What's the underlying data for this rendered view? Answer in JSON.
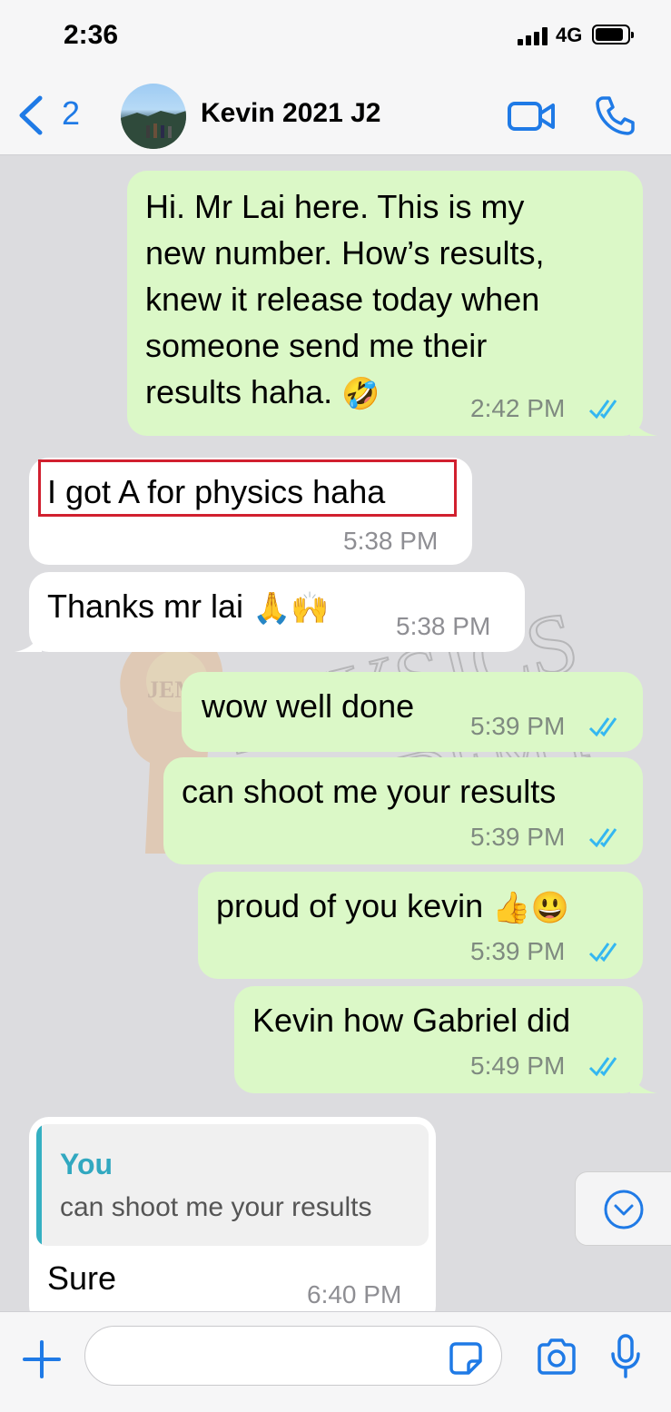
{
  "status_bar": {
    "time": "2:36",
    "network": "4G"
  },
  "header": {
    "back_count": "2",
    "contact_name": "Kevin 2021 J2"
  },
  "messages": [
    {
      "direction": "out",
      "text": "Hi. Mr Lai here. This is my\nnew number. How’s results,\nknew it release today when\nsomeone send me their\nresults haha.",
      "emoji": "🤣",
      "time": "2:42 PM",
      "read": true
    },
    {
      "direction": "in",
      "text": "I got A for physics haha",
      "time": "5:38 PM"
    },
    {
      "direction": "in",
      "text": "Thanks mr lai",
      "emoji": "🙏🙌",
      "time": "5:38 PM"
    },
    {
      "direction": "out",
      "text": "wow well done",
      "time": "5:39 PM",
      "read": true
    },
    {
      "direction": "out",
      "text": "can shoot me your results",
      "time": "5:39 PM",
      "read": true
    },
    {
      "direction": "out",
      "text": "proud of you kevin",
      "emoji": "👍😃",
      "time": "5:39 PM",
      "read": true
    },
    {
      "direction": "out",
      "text": "Kevin how Gabriel did",
      "time": "5:49 PM",
      "read": true
    },
    {
      "direction": "in",
      "quoted_author": "You",
      "quoted_text": "can shoot me your results",
      "text": "Sure",
      "time": "6:40 PM"
    }
  ],
  "watermark": {
    "line1": "PHYSICS",
    "line2": "ACADEMY",
    "logo": "JEMG"
  },
  "composer": {
    "placeholder": ""
  },
  "colors": {
    "accent": "#1f7ae6",
    "outgoing": "#dbf8c7",
    "incoming": "#ffffff",
    "highlight": "#d1202f",
    "reply_accent": "#35b0c2"
  }
}
